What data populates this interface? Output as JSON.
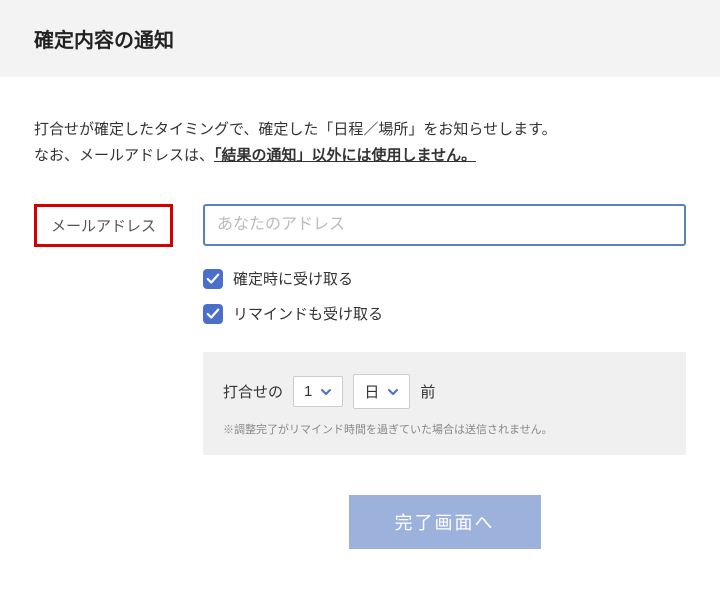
{
  "header": {
    "title": "確定内容の通知"
  },
  "description": {
    "line1": "打合せが確定したタイミングで、確定した「日程／場所」をお知らせします。",
    "line2_prefix": "なお、メールアドレスは、",
    "line2_underline": "「結果の通知」以外には使用しません。"
  },
  "form": {
    "email_label": "メールアドレス",
    "email_placeholder": "あなたのアドレス",
    "checkbox_confirm": "確定時に受け取る",
    "checkbox_remind": "リマインドも受け取る"
  },
  "remind": {
    "prefix": "打合せの",
    "number_value": "1",
    "unit_value": "日",
    "suffix": "前",
    "note": "※調整完了がリマインド時間を過ぎていた場合は送信されません。"
  },
  "submit": {
    "label": "完了画面へ"
  },
  "colors": {
    "accent": "#4a6fc9",
    "highlight_border": "#d40000"
  }
}
